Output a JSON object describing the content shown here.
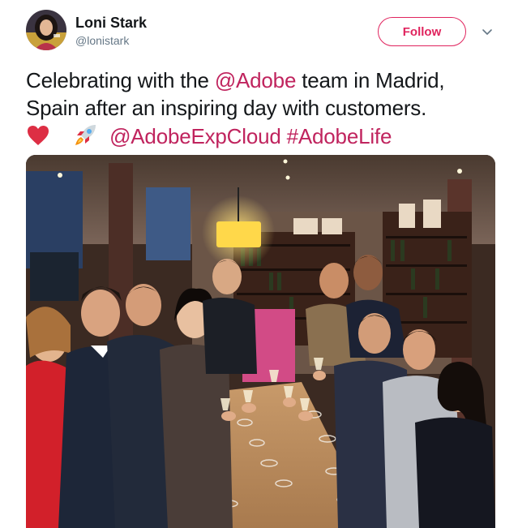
{
  "user": {
    "display_name": "Loni Stark",
    "handle": "@lonistark",
    "avatar_icon": "profile-photo"
  },
  "actions": {
    "follow_label": "Follow",
    "menu_icon": "chevron-down-icon"
  },
  "tweet": {
    "line1_a": "Celebrating with the ",
    "line1_mention": "@Adobe",
    "line1_b": " team in Madrid,",
    "line2": "Spain after an inspiring day with customers.",
    "line3_mention": "@AdobeExpCloud",
    "line3_hashtag": "#AdobeLife",
    "emojis": [
      "red-heart",
      "rocket"
    ]
  },
  "colors": {
    "accent": "#e0245e",
    "link": "#c0245e",
    "text": "#14171a",
    "muted": "#657786"
  },
  "media": {
    "type": "photo"
  }
}
